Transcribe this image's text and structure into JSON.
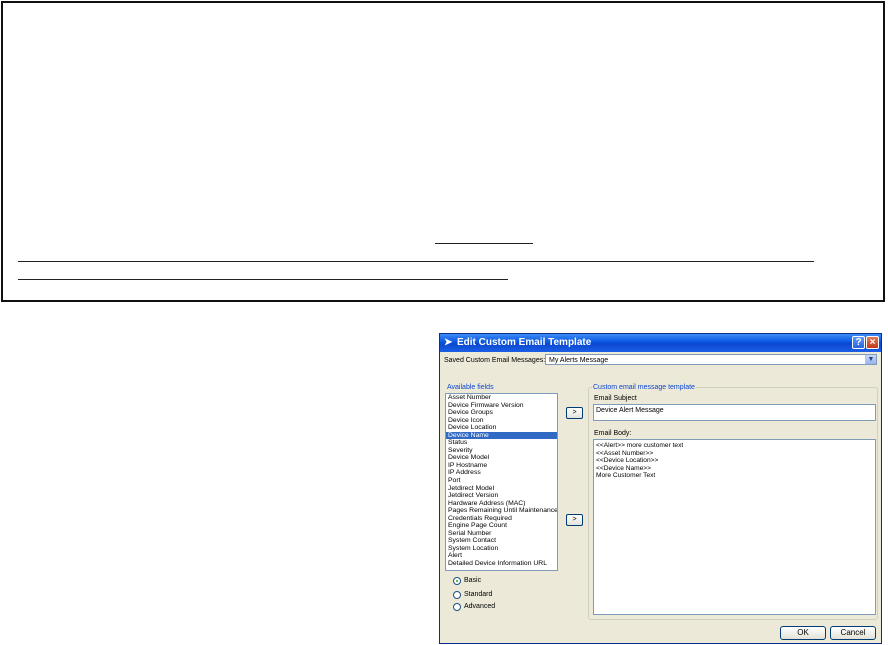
{
  "dialog": {
    "title": "Edit Custom Email Template",
    "help_label": "?",
    "close_label": "×",
    "saved_label": "Saved Custom Email Messages:",
    "saved_value": "My Alerts Message",
    "available_label": "Available fields",
    "fields": [
      "Asset Number",
      "Device Firmware Version",
      "Device Groups",
      "Device Icon",
      "Device Location",
      "Device Name",
      "Status",
      "Severity",
      "Device Model",
      "IP Hostname",
      "IP Address",
      "Port",
      "Jetdirect Model",
      "Jetdirect Version",
      "Hardware Address (MAC)",
      "Pages Remaining Until Maintenance K",
      "Credentials Required",
      "Engine Page Count",
      "Serial Number",
      "System Contact",
      "System Location",
      "Alert",
      "Detailed Device Information URL"
    ],
    "selected_field_index": 5,
    "add_to_subject_label": ">",
    "add_to_body_label": ">",
    "template_label": "Custom email message template",
    "subject_label": "Email Subject",
    "subject_value": "Device Alert Message",
    "body_label": "Email Body:",
    "body_lines": [
      "<<Alert>>  more customer text",
      "<<Asset Number>>",
      "<<Device Location>>",
      "<<Device Name>>",
      "More Customer Text"
    ],
    "radios": [
      {
        "label": "Basic",
        "checked": true
      },
      {
        "label": "Standard",
        "checked": false
      },
      {
        "label": "Advanced",
        "checked": false
      }
    ],
    "ok_label": "OK",
    "cancel_label": "Cancel",
    "title_bar_color": "#0a55e0",
    "selection_color": "#316ac5"
  }
}
